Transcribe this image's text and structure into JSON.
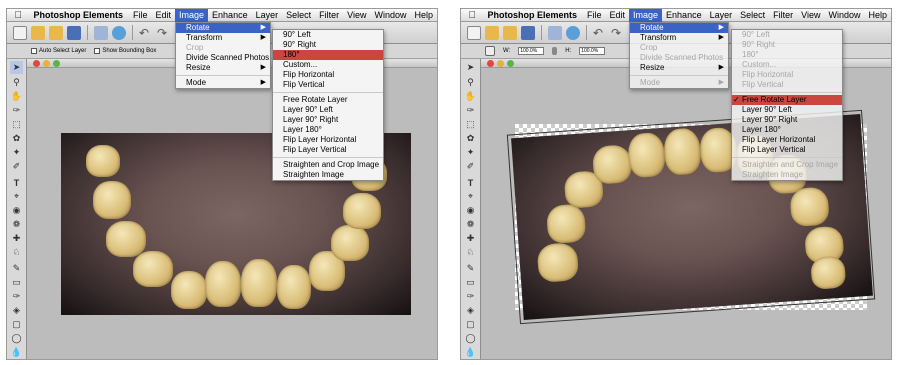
{
  "colors": {
    "menu_highlight": "#3b62c5",
    "red_highlight": "#c9473f",
    "workspace": "#b9b9b9"
  },
  "menubar": {
    "app": "Photoshop Elements",
    "items": [
      "File",
      "Edit",
      "Image",
      "Enhance",
      "Layer",
      "Select",
      "Filter",
      "View",
      "Window",
      "Help"
    ],
    "active_item": "Image"
  },
  "left": {
    "options": {
      "auto_select": "Auto Select Layer",
      "bounding_box": "Show Bounding Box"
    },
    "image_menu": [
      {
        "label": "Rotate",
        "selected": true,
        "submenu": true
      },
      {
        "label": "Transform",
        "submenu": true
      },
      {
        "label": "Crop",
        "disabled": true
      },
      {
        "label": "Divide Scanned Photos"
      },
      {
        "label": "Resize",
        "submenu": true
      },
      {
        "label": "Mode",
        "submenu": true
      }
    ],
    "rotate_menu": [
      "90° Left",
      "90° Right",
      "180°",
      "Custom...",
      "Flip Horizontal",
      "Flip Vertical",
      "Free Rotate Layer",
      "Layer 90° Left",
      "Layer 90° Right",
      "Layer 180°",
      "Flip Layer Horizontal",
      "Flip Layer Vertical",
      "Straighten and Crop Image",
      "Straighten Image"
    ],
    "highlighted": "180°"
  },
  "right": {
    "options": {
      "w_label": "W:",
      "w_value": "100.0%",
      "h_label": "H:",
      "h_value": "100.0%"
    },
    "image_menu": [
      {
        "label": "Rotate",
        "selected": true,
        "submenu": true
      },
      {
        "label": "Transform",
        "submenu": true
      },
      {
        "label": "Crop",
        "disabled": true
      },
      {
        "label": "Divide Scanned Photos",
        "disabled": true
      },
      {
        "label": "Resize",
        "submenu": true
      },
      {
        "label": "Mode",
        "disabled": true,
        "submenu": true
      }
    ],
    "rotate_menu": [
      {
        "label": "90° Left",
        "disabled": true
      },
      {
        "label": "90° Right",
        "disabled": true
      },
      {
        "label": "180°",
        "disabled": true
      },
      {
        "label": "Custom...",
        "disabled": true
      },
      {
        "label": "Flip Horizontal",
        "disabled": true
      },
      {
        "label": "Flip Vertical",
        "disabled": true
      },
      {
        "label": "Free Rotate Layer",
        "checked": true
      },
      {
        "label": "Layer 90° Left"
      },
      {
        "label": "Layer 90° Right"
      },
      {
        "label": "Layer 180°"
      },
      {
        "label": "Flip Layer Horizontal"
      },
      {
        "label": "Flip Layer Vertical"
      },
      {
        "label": "Straighten and Crop Image",
        "disabled": true
      },
      {
        "label": "Straighten Image",
        "disabled": true
      }
    ],
    "check_mark": "✓",
    "highlighted": "Free Rotate Layer"
  }
}
